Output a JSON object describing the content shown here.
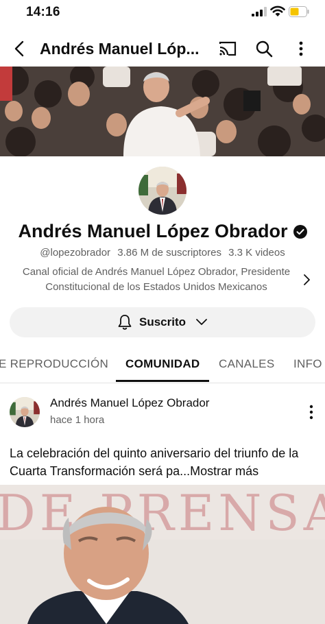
{
  "status": {
    "time": "14:16"
  },
  "app_bar": {
    "title": "Andrés Manuel Lóp..."
  },
  "channel": {
    "name": "Andrés Manuel López Obrador",
    "handle": "@lopezobrador",
    "subscribers": "3.86 M de suscriptores",
    "videos": "3.3 K videos",
    "description_line1": "Canal oficial de Andrés Manuel López Obrador,  Presidente",
    "description_line2": "Constitucional de los Estados Unidos Mexicanos",
    "subscribe_label": "Suscrito"
  },
  "tabs": [
    {
      "label": "E REPRODUCCIÓN"
    },
    {
      "label": "COMUNIDAD",
      "active": true
    },
    {
      "label": "CANALES"
    },
    {
      "label": "INFO"
    }
  ],
  "post": {
    "author": "Andrés Manuel López Obrador",
    "time": "hace 1 hora",
    "text": "La celebración del quinto aniversario del triunfo de la Cuarta Transformación será pa...",
    "more_label": "Mostrar más"
  },
  "colors": {
    "text": "#0f0f0f",
    "secondary": "#606060",
    "chip_bg": "#f2f2f2",
    "battery": "#f5c400"
  },
  "icons": [
    "back-icon",
    "cast-icon",
    "search-icon",
    "more-vert-icon",
    "verified-icon",
    "chevron-right-icon",
    "bell-icon",
    "chevron-down-icon"
  ]
}
